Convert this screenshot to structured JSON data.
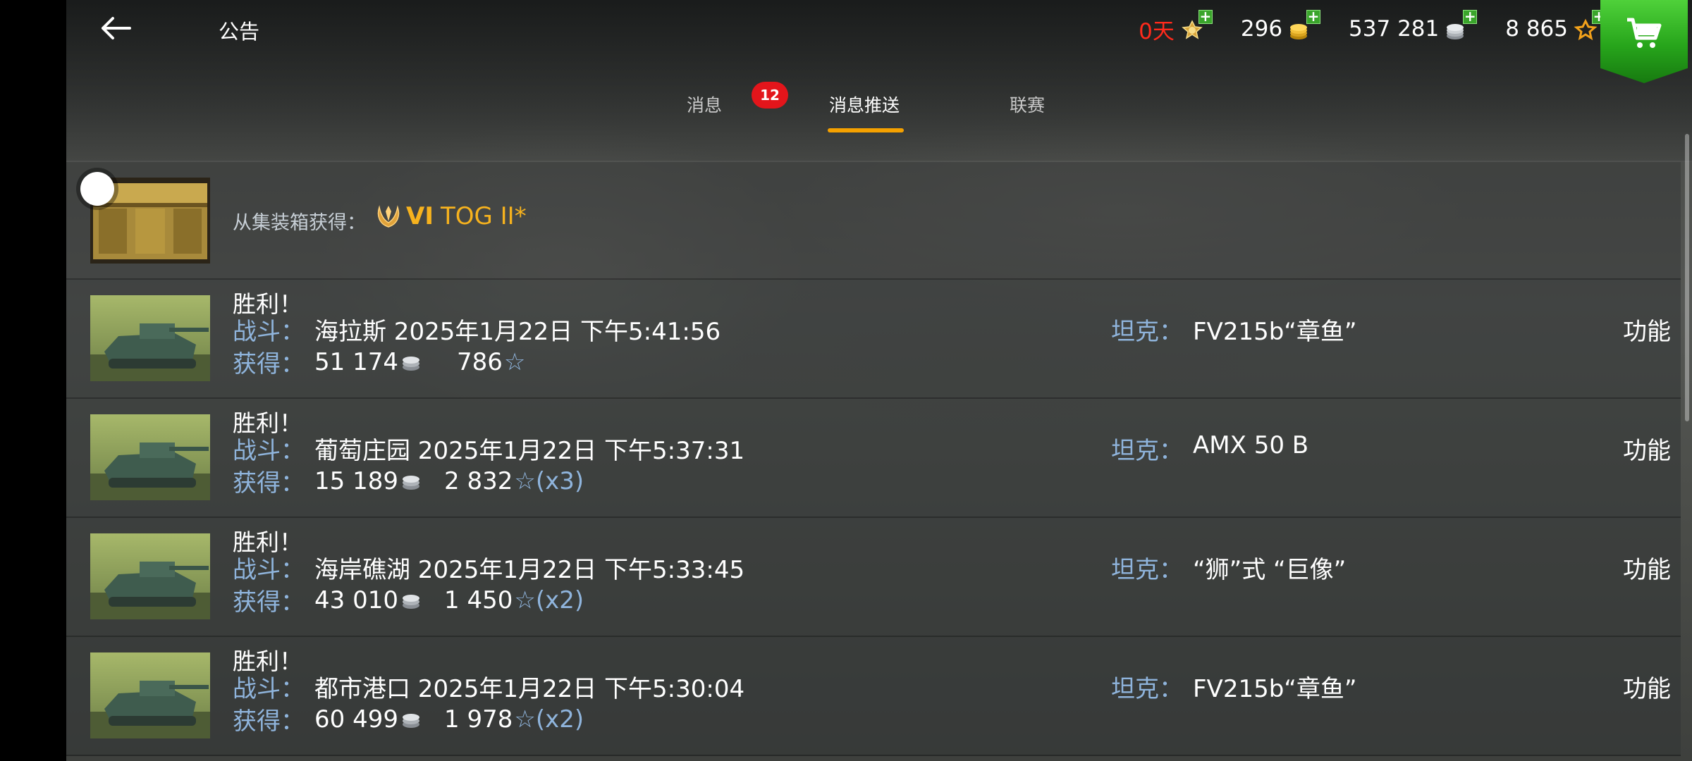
{
  "header": {
    "title": "公告",
    "currencies": {
      "premium": "0天",
      "gold": "296",
      "credits": "537 281",
      "free_xp": "8 865"
    }
  },
  "tabs": [
    {
      "label": "消息",
      "badge": "12"
    },
    {
      "label": "消息推送",
      "active": true
    },
    {
      "label": "联赛"
    }
  ],
  "box_reward": {
    "label": "从集装箱获得：",
    "tier": "VI",
    "tank": "TOG II*"
  },
  "battles": [
    {
      "title": "胜利！",
      "battle_label": "战斗：",
      "battle": "海拉斯 2025年1月22日 下午5:41:56",
      "earn_label": "获得：",
      "credits": "51 174",
      "xp": "786",
      "mult": "",
      "tank_label": "坦克：",
      "tank": "FV215b“章鱼”",
      "action": "功能"
    },
    {
      "title": "胜利！",
      "battle_label": "战斗：",
      "battle": "葡萄庄园 2025年1月22日 下午5:37:31",
      "earn_label": "获得：",
      "credits": "15 189",
      "xp": "2 832",
      "mult": "(x3)",
      "tank_label": "坦克：",
      "tank": "AMX 50 B",
      "action": "功能"
    },
    {
      "title": "胜利！",
      "battle_label": "战斗：",
      "battle": "海岸礁湖 2025年1月22日 下午5:33:45",
      "earn_label": "获得：",
      "credits": "43 010",
      "xp": "1 450",
      "mult": "(x2)",
      "tank_label": "坦克：",
      "tank": "“狮”式 “巨像”",
      "action": "功能"
    },
    {
      "title": "胜利！",
      "battle_label": "战斗：",
      "battle": "都市港口 2025年1月22日 下午5:30:04",
      "earn_label": "获得：",
      "credits": "60 499",
      "xp": "1 978",
      "mult": "(x2)",
      "tank_label": "坦克：",
      "tank": "FV215b“章鱼”",
      "action": "功能"
    }
  ],
  "colors": {
    "accent_underline": "#f5a100",
    "label_blue": "#8fb4dc",
    "premium_red": "#ff2a1c",
    "shop_green": "#27a51b",
    "badge_red": "#e3151b",
    "tank_gold": "#f6b21e"
  }
}
